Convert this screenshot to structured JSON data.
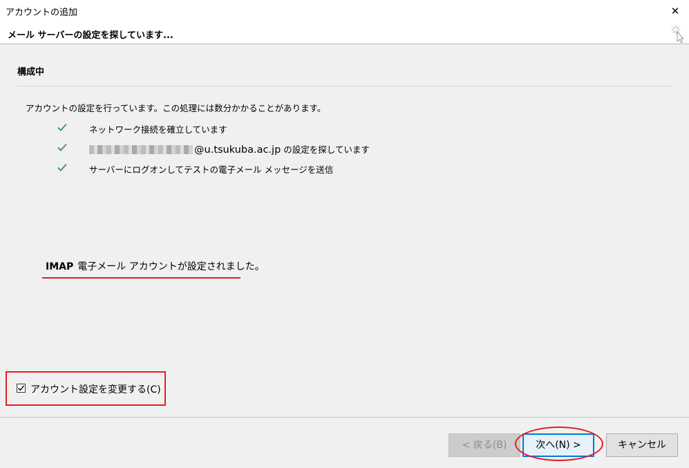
{
  "window": {
    "title": "アカウントの追加",
    "close_icon": "close-icon"
  },
  "header": {
    "subtitle": "メール サーバーの設定を探しています...",
    "busy_icon": "busy-cursor-icon"
  },
  "main": {
    "section_title": "構成中",
    "description": "アカウントの設定を行っています。この処理には数分かかることがあります。",
    "steps": [
      {
        "icon": "check-icon",
        "label": "ネットワーク接続を確立しています"
      },
      {
        "icon": "check-icon",
        "email_domain": "@u.tsukuba.ac.jp",
        "label_suffix": " の設定を探しています"
      },
      {
        "icon": "check-icon",
        "label": "サーバーにログオンしてテストの電子メール メッセージを送信"
      }
    ],
    "result": {
      "protocol": "IMAP",
      "message": "電子メール アカウントが設定されました。"
    },
    "change_settings": {
      "label": "アカウント設定を変更する(C)",
      "checked": true
    }
  },
  "footer": {
    "back_label": "< 戻る(B)",
    "next_label": "次へ(N) >",
    "cancel_label": "キャンセル"
  },
  "colors": {
    "check": "#4f8f82",
    "annotation_red": "#e31b23",
    "primary_border": "#0078d7"
  }
}
